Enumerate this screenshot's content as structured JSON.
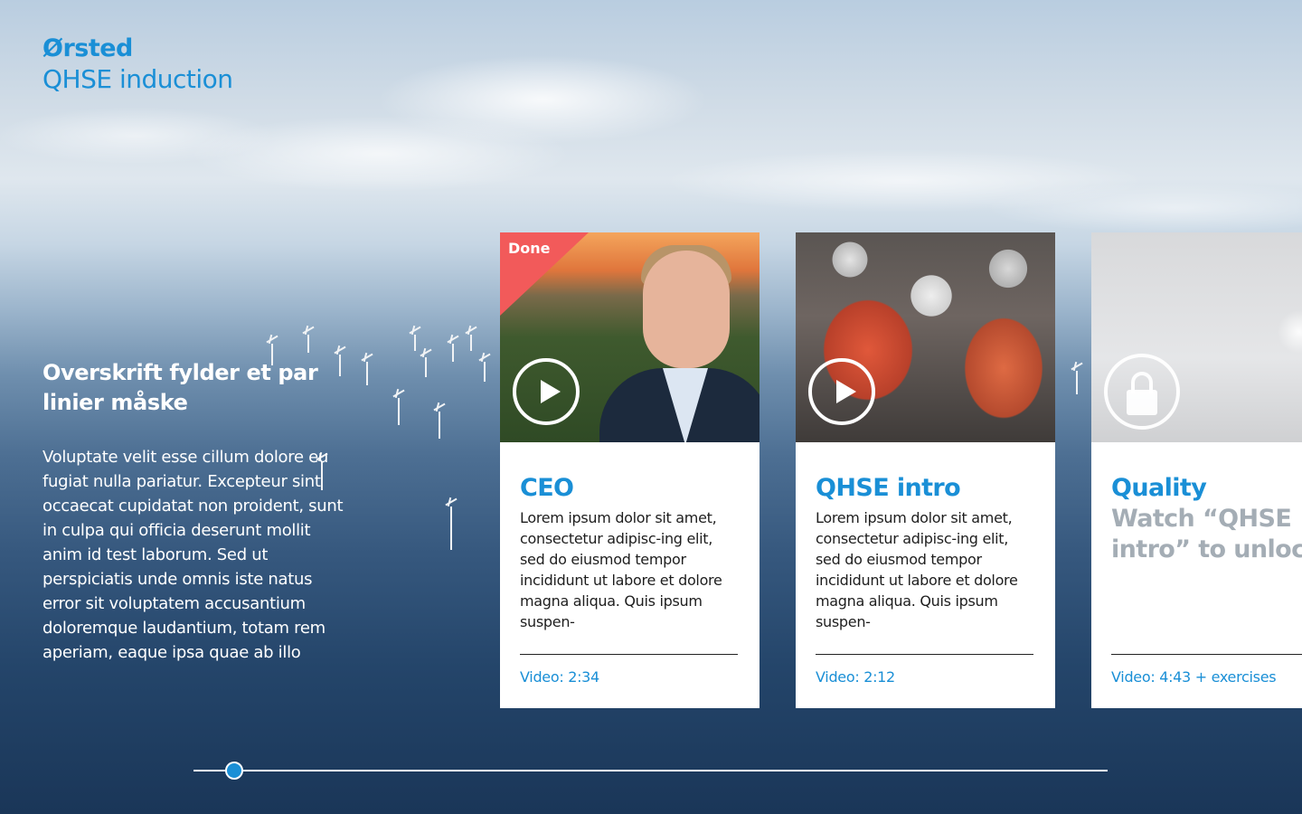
{
  "brand": {
    "name": "Ørsted",
    "subtitle": "QHSE induction"
  },
  "intro": {
    "heading": "Overskrift fylder et par linier måske",
    "body": "Voluptate velit esse cillum dolore eu fugiat nulla pariatur. Excepteur sint occaecat cupidatat non proident, sunt in culpa qui officia deserunt mollit anim id test laborum. Sed ut perspiciatis unde omnis iste natus error sit voluptatem accusantium doloremque laudantium, totam rem aperiam, eaque ipsa quae ab illo"
  },
  "cards": [
    {
      "title": "CEO",
      "status": "Done",
      "text": "Lorem ipsum dolor sit amet, consectetur adipisc-ing elit, sed do eiusmod tempor incididunt ut labore et dolore magna aliqua. Quis ipsum suspen-",
      "meta": "Video: 2:34",
      "icon": "play-icon"
    },
    {
      "title": "QHSE intro",
      "text": "Lorem ipsum dolor sit amet, consectetur adipisc-ing elit, sed do eiusmod tempor incididunt ut labore et dolore magna aliqua. Quis ipsum suspen-",
      "meta": "Video: 2:12",
      "icon": "play-icon"
    },
    {
      "title": "Quality",
      "lock_text_line1": "Watch “QHSE",
      "lock_text_line2": "intro” to unlock",
      "meta": "Video: 4:43 + exercises",
      "icon": "lock-icon",
      "locked": true
    }
  ],
  "colors": {
    "accent": "#1a8fd6",
    "done": "#f25a5a",
    "locked_text": "#a4adb5"
  },
  "slider": {
    "position": 0.044
  }
}
